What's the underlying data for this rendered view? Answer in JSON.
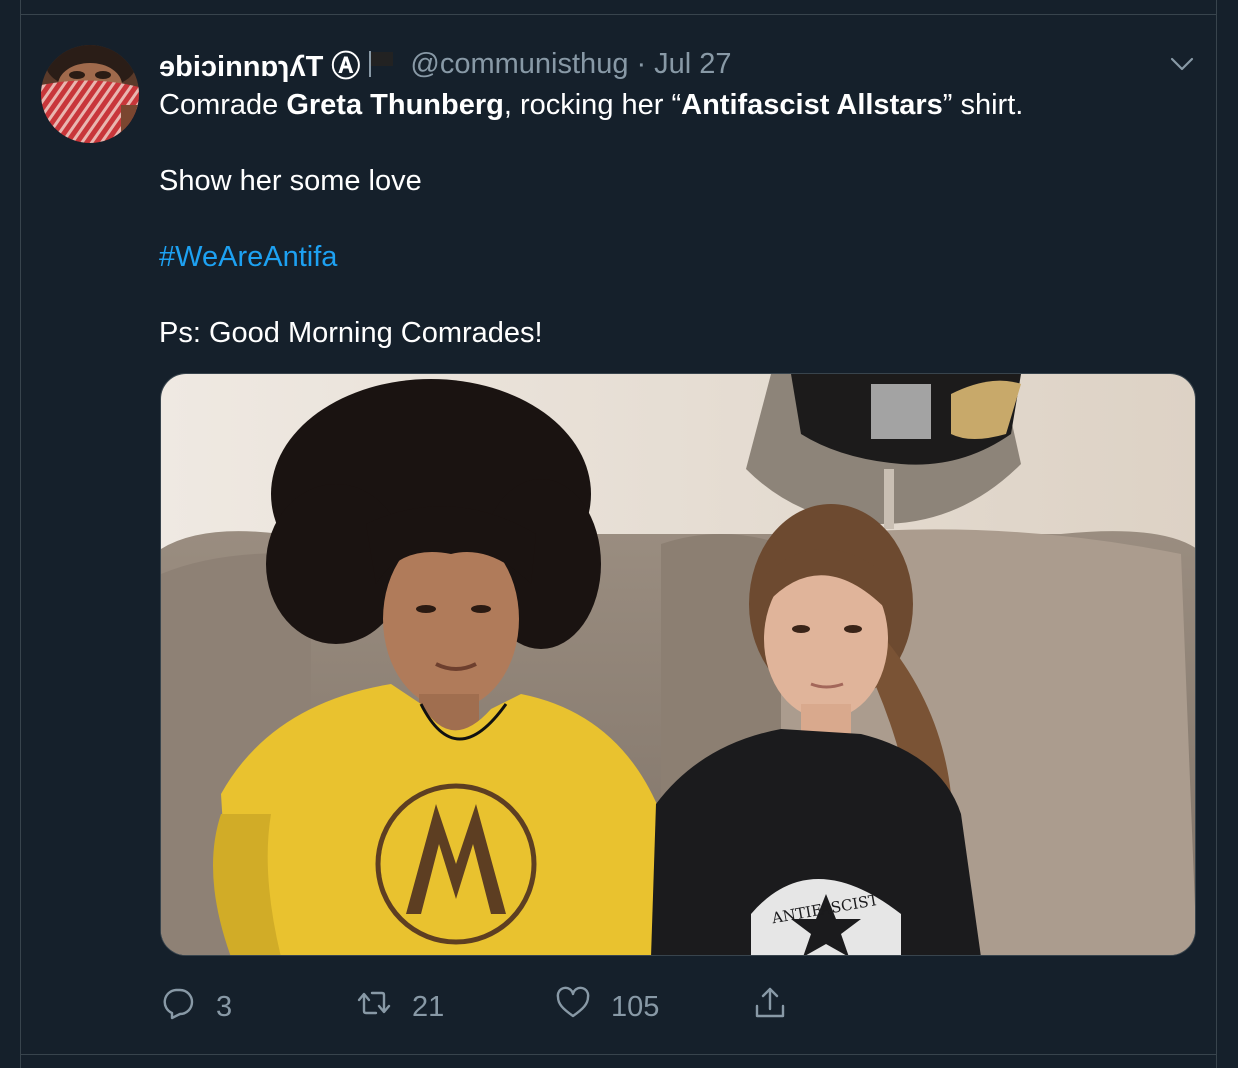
{
  "tweet": {
    "display_name": "ɘbiɔinnɒɿʎT Ⓐ",
    "flag_icon": "black-flag-icon",
    "handle": "@communisthug",
    "separator": "·",
    "date": "Jul 27",
    "text": {
      "line1_pre": "Comrade ",
      "line1_bold1": "Greta Thunberg",
      "line1_mid": ", rocking her “",
      "line1_bold2": "Antifascist Allstars",
      "line1_post": "” shirt.",
      "line2": "Show her some love",
      "hashtag": "#WeAreAntifa",
      "line4": "Ps: Good Morning Comrades!"
    },
    "image_shirt_text": "ANTIFASCIST"
  },
  "actions": {
    "reply_count": "3",
    "retweet_count": "21",
    "like_count": "105"
  },
  "colors": {
    "background": "#15202b",
    "border": "#38444d",
    "secondary_text": "#8899a6",
    "link": "#1da1f2"
  }
}
